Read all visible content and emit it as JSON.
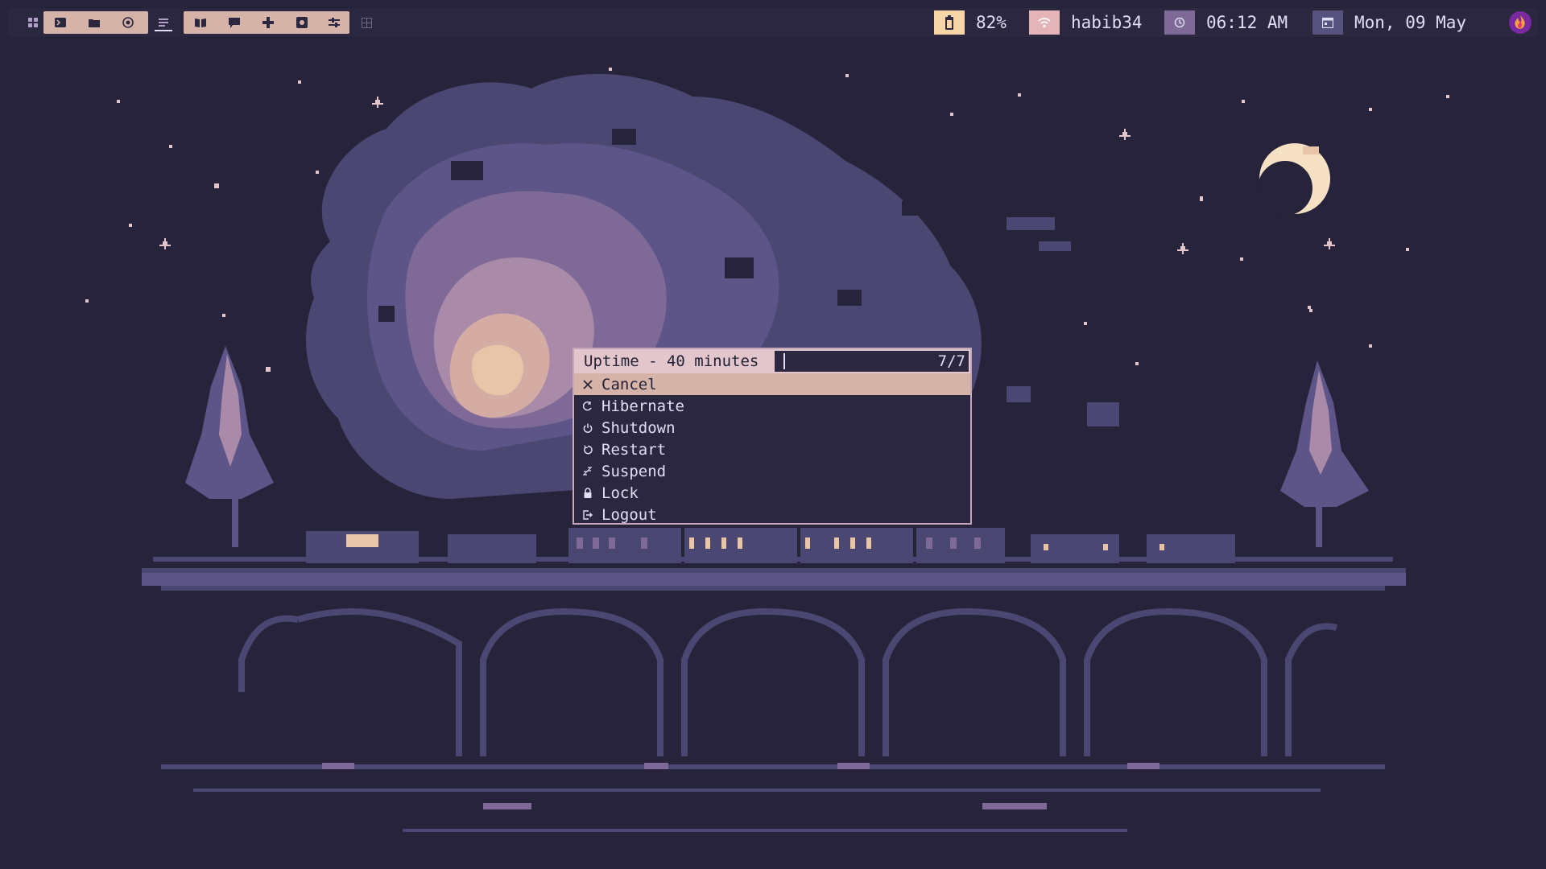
{
  "topbar": {
    "workspaces": [
      {
        "name": "grid-icon"
      },
      {
        "name": "terminal-icon"
      },
      {
        "name": "folder-icon"
      },
      {
        "name": "firefox-icon"
      },
      {
        "name": "editor-icon"
      },
      {
        "name": "book-icon"
      },
      {
        "name": "chat-icon"
      },
      {
        "name": "gamepad-icon"
      },
      {
        "name": "settings-icon"
      },
      {
        "name": "mixer-icon"
      },
      {
        "name": "empty-workspace-icon"
      }
    ],
    "battery": {
      "icon": "battery-icon",
      "value": "82%",
      "color": "#f6d5a8"
    },
    "network": {
      "icon": "wifi-icon",
      "value": "habib34",
      "color": "#e3b4b8"
    },
    "clock": {
      "icon": "clock-icon",
      "value": "06:12 AM",
      "color": "#b99ed4"
    },
    "date": {
      "icon": "calendar-icon",
      "value": "Mon, 09 May",
      "color": "#8f8ec7"
    },
    "launcher": {
      "icon": "launcher-icon"
    }
  },
  "menu": {
    "prompt": "Uptime - 40 minutes",
    "input_value": "",
    "counter": "7/7",
    "items": [
      {
        "icon": "close-icon",
        "label": "Cancel",
        "selected": true
      },
      {
        "icon": "hibernate-icon",
        "label": "Hibernate"
      },
      {
        "icon": "power-icon",
        "label": "Shutdown"
      },
      {
        "icon": "restart-icon",
        "label": "Restart"
      },
      {
        "icon": "sleep-icon",
        "label": "Suspend"
      },
      {
        "icon": "lock-icon",
        "label": "Lock"
      },
      {
        "icon": "logout-icon",
        "label": "Logout"
      }
    ]
  },
  "colors": {
    "background": "#26233a",
    "bar": "#2a273f",
    "accent": "#d6b3a8",
    "text": "#e0def4"
  }
}
